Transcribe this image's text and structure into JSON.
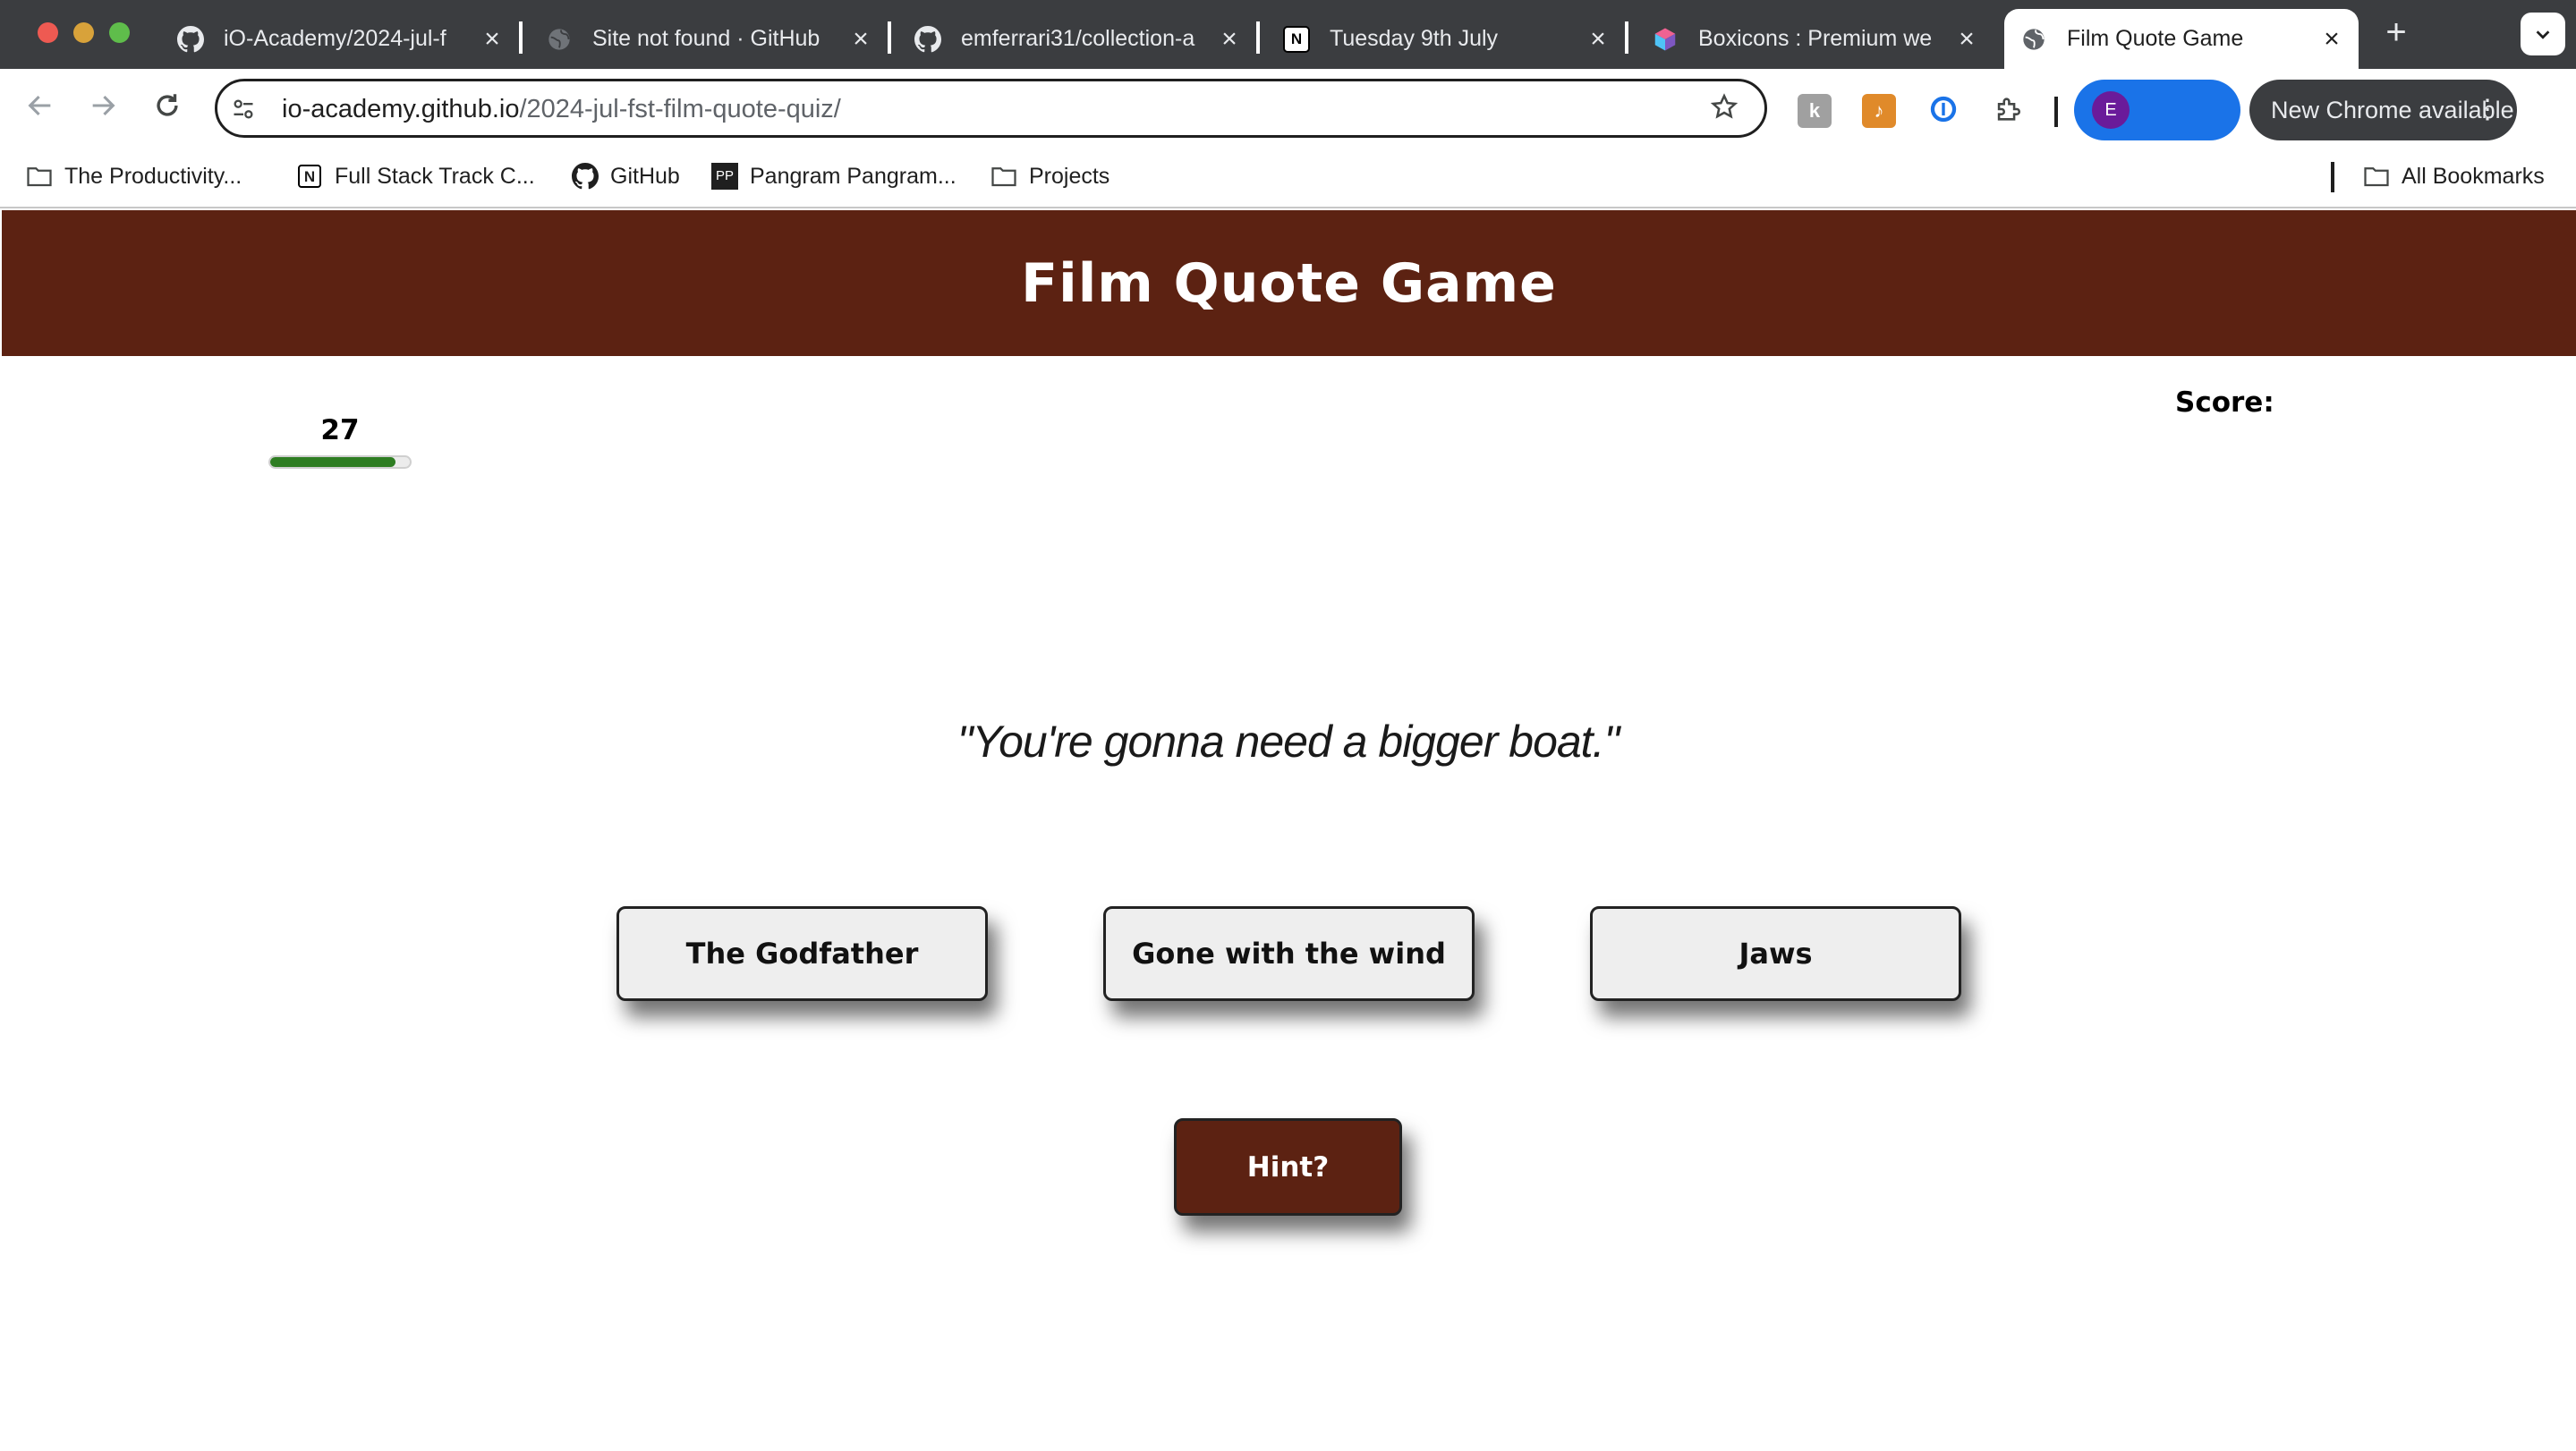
{
  "browser": {
    "tabs": [
      {
        "title": "iO-Academy/2024-jul-f",
        "favicon": "github-icon"
      },
      {
        "title": "Site not found · GitHub",
        "favicon": "globe-icon"
      },
      {
        "title": "emferrari31/collection-a",
        "favicon": "github-icon"
      },
      {
        "title": "Tuesday 9th July",
        "favicon": "notion-icon"
      },
      {
        "title": "Boxicons : Premium we",
        "favicon": "boxicons-icon"
      },
      {
        "title": "Film Quote Game",
        "favicon": "globe-icon",
        "active": true
      }
    ],
    "address_bar": {
      "host": "io-academy.github.io",
      "path": "/2024-jul-fst-film-quote-quiz/"
    },
    "profile_initial": "E",
    "update_label": "New Chrome available",
    "bookmarks": [
      {
        "label": "The Productivity...",
        "icon": "folder-icon"
      },
      {
        "label": "Full Stack Track C...",
        "icon": "notion-icon"
      },
      {
        "label": "GitHub",
        "icon": "github-icon"
      },
      {
        "label": "Pangram Pangram...",
        "icon": "pangram-icon"
      },
      {
        "label": "Projects",
        "icon": "folder-icon"
      }
    ],
    "all_bookmarks_label": "All Bookmarks",
    "pangram_badge": "PP",
    "notion_badge": "N"
  },
  "game": {
    "title": "Film Quote Game",
    "timer_value": "27",
    "timer_fraction": 0.9,
    "score_label": "Score:",
    "quote": "\"You're gonna need a bigger boat.\"",
    "answers": [
      "The Godfather",
      "Gone with the wind",
      "Jaws"
    ],
    "hint_label": "Hint?"
  },
  "colors": {
    "header_bg": "#5c2212",
    "timer_fill": "#2e7d22",
    "hint_bg": "#5c2212",
    "answer_bg": "#eeeeee",
    "profile_pill": "#1a73e8"
  }
}
